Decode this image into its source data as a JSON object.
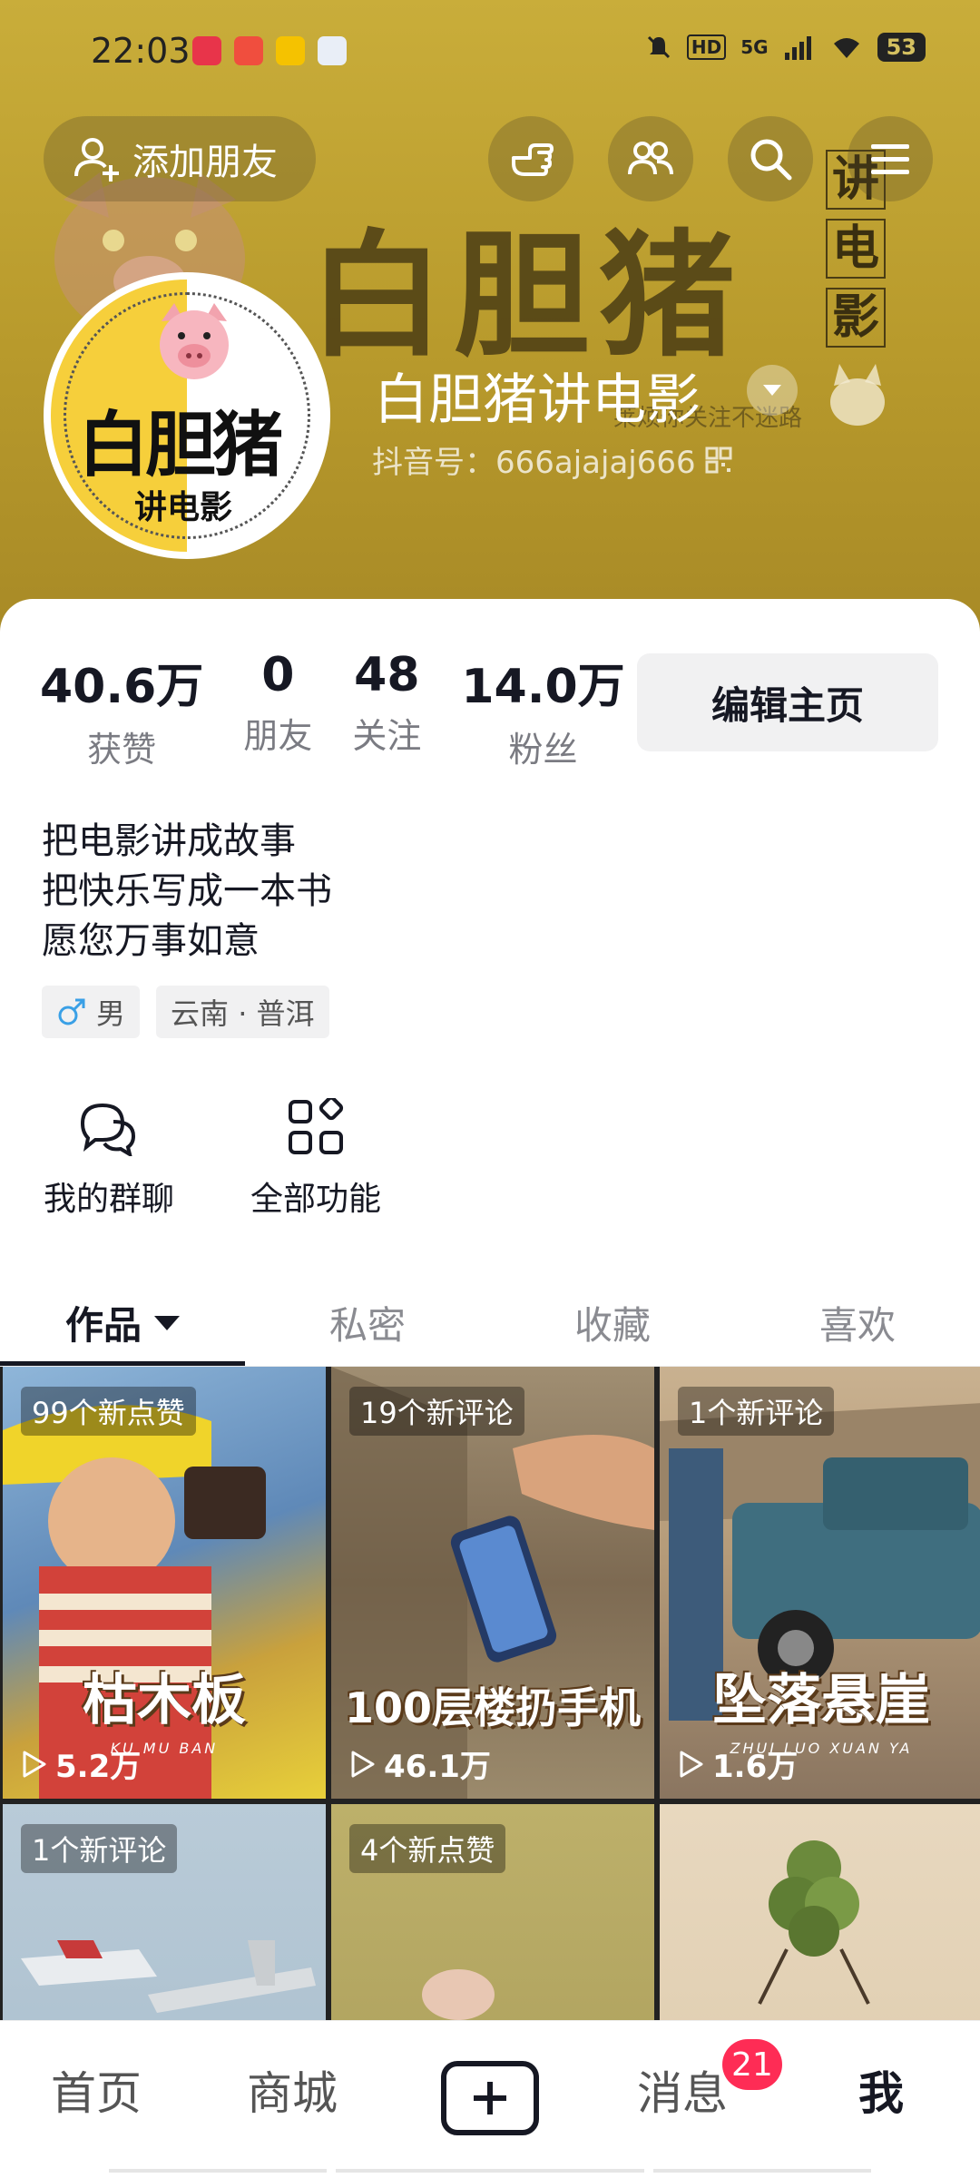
{
  "status": {
    "time": "22:03",
    "network": "5G",
    "hd": "HD",
    "battery": "53"
  },
  "header": {
    "add_friend": "添加朋友",
    "banner_title": "白胆猪",
    "banner_side": [
      "讲",
      "电",
      "影"
    ],
    "banner_slogan": "莱烦你关注不迷路"
  },
  "avatar": {
    "title": "白胆猪",
    "sub": "讲电影"
  },
  "profile": {
    "name": "白胆猪讲电影",
    "id_label": "抖音号：666ajajaj666"
  },
  "stats": [
    {
      "num": "40.6万",
      "label": "获赞"
    },
    {
      "num": "0",
      "label": "朋友"
    },
    {
      "num": "48",
      "label": "关注"
    },
    {
      "num": "14.0万",
      "label": "粉丝"
    }
  ],
  "edit_button": "编辑主页",
  "bio": [
    "把电影讲成故事",
    "把快乐写成一本书",
    "愿您万事如意"
  ],
  "tags": {
    "gender": "男",
    "location": "云南 · 普洱"
  },
  "quick": {
    "group_chat": "我的群聊",
    "all_features": "全部功能"
  },
  "tabs": [
    "作品",
    "私密",
    "收藏",
    "喜欢"
  ],
  "videos": [
    {
      "badge": "99个新点赞",
      "caption": "枯木板",
      "sub": "KU MU BAN",
      "plays": "5.2万"
    },
    {
      "badge": "19个新评论",
      "caption": "100层楼扔手机",
      "sub": "",
      "plays": "46.1万"
    },
    {
      "badge": "1个新评论",
      "caption": "坠落悬崖",
      "sub": "ZHUI LUO XUAN YA",
      "plays": "1.6万"
    },
    {
      "badge": "1个新评论",
      "caption": "",
      "sub": "",
      "plays": ""
    },
    {
      "badge": "4个新点赞",
      "caption": "",
      "sub": "",
      "plays": ""
    },
    {
      "badge": "",
      "caption": "",
      "sub": "",
      "plays": ""
    }
  ],
  "bottom_nav": {
    "home": "首页",
    "mall": "商城",
    "messages": "消息",
    "messages_badge": "21",
    "me": "我"
  }
}
